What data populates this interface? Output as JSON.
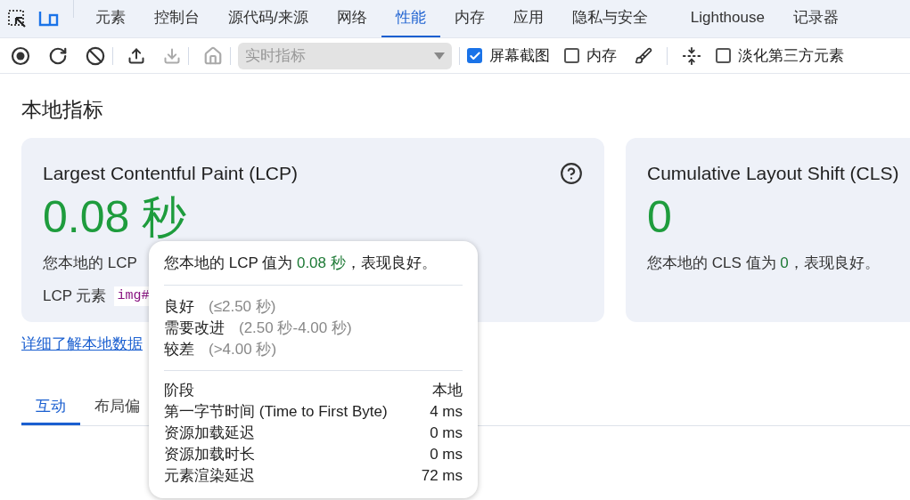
{
  "panel_tabs": [
    {
      "label": "元素",
      "selected": false
    },
    {
      "label": "控制台",
      "selected": false
    },
    {
      "label": "源代码/来源",
      "selected": false
    },
    {
      "label": "网络",
      "selected": false
    },
    {
      "label": "性能",
      "selected": true
    },
    {
      "label": "内存",
      "selected": false
    },
    {
      "label": "应用",
      "selected": false
    },
    {
      "label": "隐私与安全",
      "selected": false
    },
    {
      "label": "Lighthouse",
      "selected": false
    },
    {
      "label": "记录器",
      "selected": false
    }
  ],
  "toolbar": {
    "select": {
      "placeholder": "实时指标",
      "disabled": true
    },
    "checkboxes": [
      {
        "label": "屏幕截图",
        "checked": true
      },
      {
        "label": "内存",
        "checked": false
      },
      {
        "label": "淡化第三方元素",
        "checked": false
      }
    ]
  },
  "section_title": "本地指标",
  "cards": [
    {
      "title": "Largest Contentful Paint (LCP)",
      "value": "0.08 秒",
      "description": "您本地的 LCP",
      "element_label": "LCP 元素",
      "element_code": "img#"
    },
    {
      "title": "Cumulative Layout Shift (CLS)",
      "value": "0",
      "description": {
        "before": "您本地的 CLS 值为 ",
        "value": "0",
        "after": "，表现良好。"
      }
    }
  ],
  "link": "详细了解本地数据",
  "tabs": [
    {
      "label": "互动",
      "selected": true
    },
    {
      "label": "布局偏",
      "selected": false
    }
  ],
  "tooltip": {
    "summary": {
      "before": "您本地的 LCP 值为 ",
      "value": "0.08 秒",
      "after": "，表现良好。"
    },
    "thresholds": [
      {
        "label": "良好",
        "range": "(≤2.50 秒)"
      },
      {
        "label": "需要改进",
        "range": "(2.50 秒-4.00 秒)"
      },
      {
        "label": "较差",
        "range": "(>4.00 秒)"
      }
    ],
    "phases": {
      "header": [
        "阶段",
        "本地"
      ],
      "rows": [
        [
          "第一字节时间 (Time to First Byte)",
          "4 ms"
        ],
        [
          "资源加载延迟",
          "0 ms"
        ],
        [
          "资源加载时长",
          "0 ms"
        ],
        [
          "元素渲染延迟",
          "72 ms"
        ]
      ]
    }
  }
}
